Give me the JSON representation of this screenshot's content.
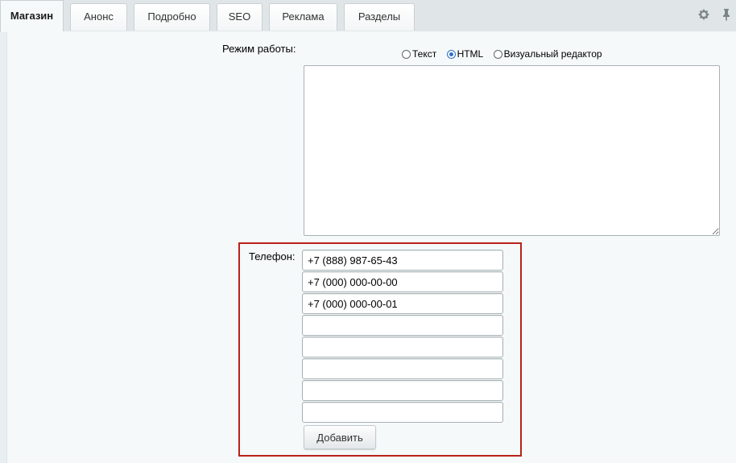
{
  "tabs": [
    {
      "label": "Магазин",
      "active": true
    },
    {
      "label": "Анонс"
    },
    {
      "label": "Подробно"
    },
    {
      "label": "SEO"
    },
    {
      "label": "Реклама"
    },
    {
      "label": "Разделы"
    }
  ],
  "toolbar": {
    "settings_icon": "gear-icon",
    "pin_icon": "pin-icon"
  },
  "work_mode": {
    "label": "Режим работы:",
    "options": [
      {
        "label": "Текст",
        "checked": false
      },
      {
        "label": "HTML",
        "checked": true
      },
      {
        "label": "Визуальный редактор",
        "checked": false
      }
    ],
    "content": ""
  },
  "phone": {
    "label": "Телефон:",
    "values": [
      "+7 (888) 987-65-43",
      "+7 (000) 000-00-00",
      "+7 (000) 000-00-01",
      "",
      "",
      "",
      "",
      ""
    ],
    "add_button": "Добавить"
  },
  "colors": {
    "highlight_border": "#b8221c",
    "accent": "#2b70c8"
  }
}
